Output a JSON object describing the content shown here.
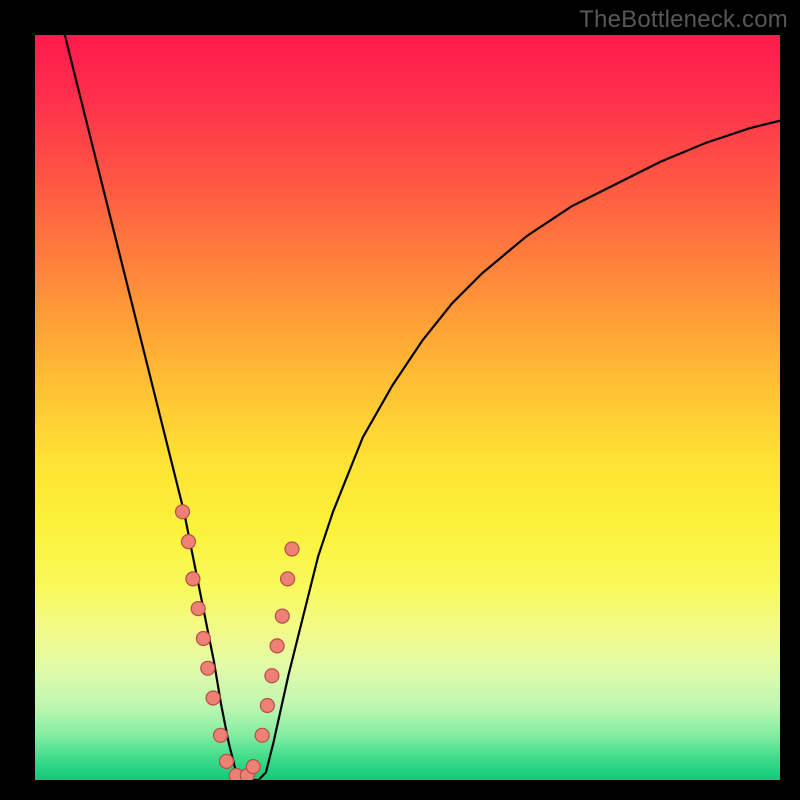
{
  "watermark": "TheBottleneck.com",
  "chart_data": {
    "type": "line",
    "title": "",
    "xlabel": "",
    "ylabel": "",
    "xlim": [
      0,
      100
    ],
    "ylim": [
      0,
      100
    ],
    "grid": false,
    "legend": false,
    "series": [
      {
        "name": "bottleneck-curve",
        "x": [
          4,
          6,
          8,
          10,
          12,
          14,
          16,
          18,
          20,
          21,
          22,
          23,
          24,
          25,
          26,
          27,
          28,
          29,
          30,
          31,
          32,
          34,
          36,
          38,
          40,
          44,
          48,
          52,
          56,
          60,
          66,
          72,
          78,
          84,
          90,
          96,
          100
        ],
        "y": [
          100,
          92,
          84,
          76,
          68,
          60,
          52,
          44,
          36,
          31,
          26,
          21,
          16,
          10,
          5,
          1,
          0,
          0,
          0,
          1,
          5,
          14,
          22,
          30,
          36,
          46,
          53,
          59,
          64,
          68,
          73,
          77,
          80,
          83,
          85.5,
          87.5,
          88.5
        ]
      }
    ],
    "points": {
      "name": "sample-markers",
      "x": [
        19.8,
        20.6,
        21.2,
        21.9,
        22.6,
        23.2,
        23.9,
        24.9,
        25.7,
        27.0,
        28.5,
        29.3,
        30.5,
        31.2,
        31.8,
        32.5,
        33.2,
        33.9,
        34.5
      ],
      "y": [
        36,
        32,
        27,
        23,
        19,
        15,
        11,
        6,
        2.5,
        0.6,
        0.6,
        1.8,
        6,
        10,
        14,
        18,
        22,
        27,
        31
      ]
    },
    "background_gradient": {
      "top": "#ff1a4b",
      "mid": "#ffe233",
      "bottom": "#18c779"
    }
  }
}
